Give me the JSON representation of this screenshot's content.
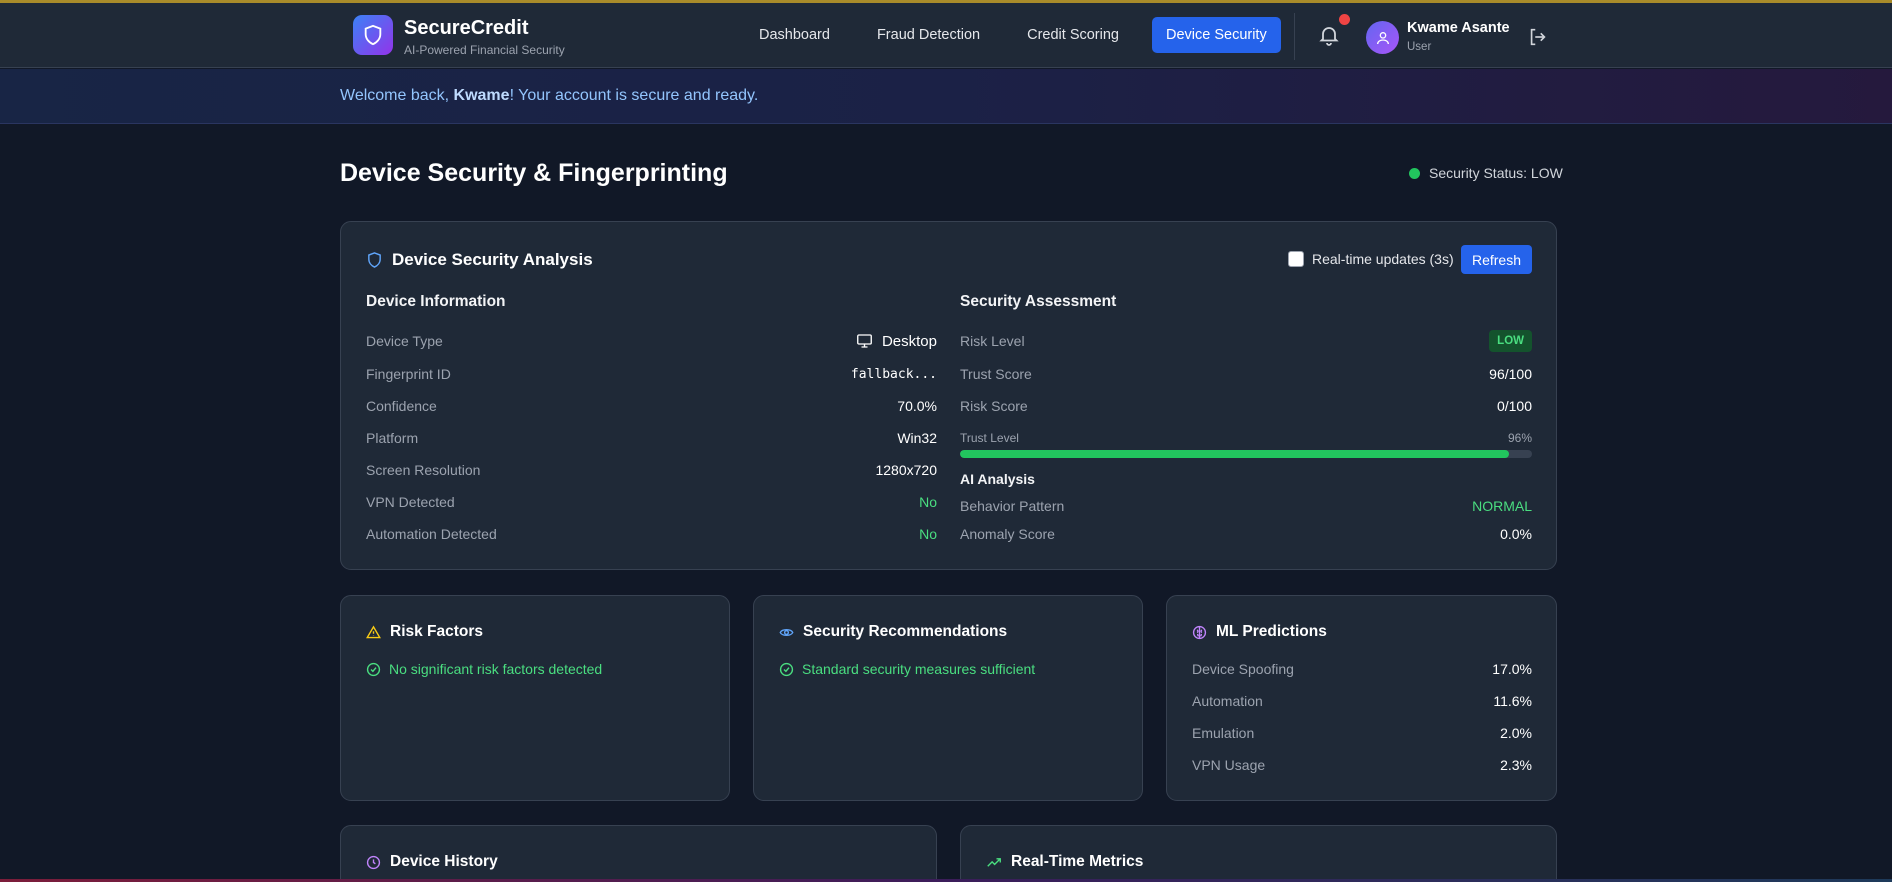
{
  "header": {
    "brand": "SecureCredit",
    "tagline": "AI-Powered Financial Security",
    "nav": [
      {
        "label": "Dashboard"
      },
      {
        "label": "Fraud Detection"
      },
      {
        "label": "Credit Scoring"
      },
      {
        "label": "Device Security",
        "active": true
      }
    ],
    "user_name": "Kwame Asante",
    "user_role": "User"
  },
  "welcome": {
    "prefix": "Welcome back, ",
    "name": "Kwame",
    "suffix": "! Your account is secure and ready."
  },
  "page": {
    "title": "Device Security & Fingerprinting",
    "security_status": "Security Status: LOW"
  },
  "analysis": {
    "title": "Device Security Analysis",
    "realtime_label": "Real-time updates (3s)",
    "refresh_label": "Refresh",
    "device_info_heading": "Device Information",
    "device_info": [
      {
        "label": "Device Type",
        "value": "Desktop"
      },
      {
        "label": "Fingerprint ID",
        "value": "fallback..."
      },
      {
        "label": "Confidence",
        "value": "70.0%"
      },
      {
        "label": "Platform",
        "value": "Win32"
      },
      {
        "label": "Screen Resolution",
        "value": "1280x720"
      },
      {
        "label": "VPN Detected",
        "value": "No"
      },
      {
        "label": "Automation Detected",
        "value": "No"
      }
    ],
    "assessment_heading": "Security Assessment",
    "risk_level_label": "Risk Level",
    "risk_level": "LOW",
    "trust_score_label": "Trust Score",
    "trust_score": "96/100",
    "risk_score_label": "Risk Score",
    "risk_score": "0/100",
    "trust_level_label": "Trust Level",
    "trust_level_text": "96%",
    "trust_level": 96,
    "ai_heading": "AI Analysis",
    "behavior_label": "Behavior Pattern",
    "behavior": "NORMAL",
    "anomaly_label": "Anomaly Score",
    "anomaly": "0.0%"
  },
  "risk_factors": {
    "title": "Risk Factors",
    "message": "No significant risk factors detected"
  },
  "recommendations": {
    "title": "Security Recommendations",
    "message": "Standard security measures sufficient"
  },
  "ml": {
    "title": "ML Predictions",
    "items": [
      {
        "label": "Device Spoofing",
        "value": "17.0%"
      },
      {
        "label": "Automation",
        "value": "11.6%"
      },
      {
        "label": "Emulation",
        "value": "2.0%"
      },
      {
        "label": "VPN Usage",
        "value": "2.3%"
      }
    ]
  },
  "history": {
    "title": "Device History"
  },
  "metrics": {
    "title": "Real-Time Metrics"
  },
  "colors": {
    "accent": "#2563eb",
    "success": "#22c55e",
    "card": "#1f2937"
  }
}
